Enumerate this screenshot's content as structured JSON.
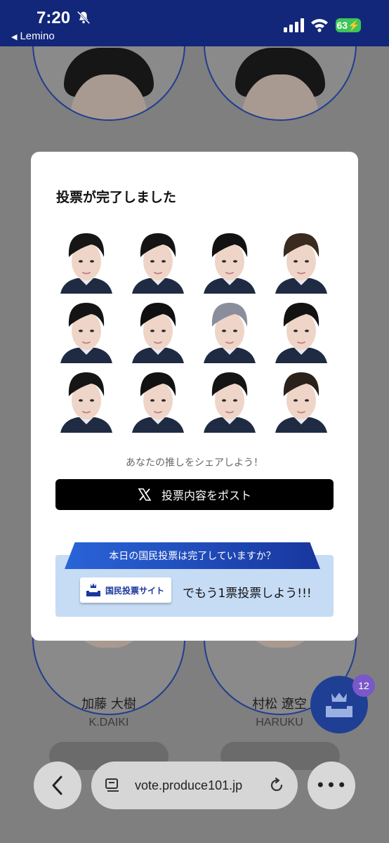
{
  "status_bar": {
    "time": "7:20",
    "back_app": "Lemino",
    "battery": "63"
  },
  "background": {
    "candidates": [
      {
        "name": "加藤 大樹",
        "romaji": "K.DAIKI"
      },
      {
        "name": "村松 遼空",
        "romaji": "HARUKU"
      }
    ],
    "fab_badge": "12"
  },
  "modal": {
    "title": "投票が完了しました",
    "share_hint": "あなたの推しをシェアしよう！",
    "post_button": "投票内容をポスト",
    "banner": "本日の国民投票は完了していますか？",
    "site_chip": "国民投票サイト",
    "vote_text": "でもう1票投票しよう!!!",
    "photo_count": 12
  },
  "browser": {
    "url": "vote.produce101.jp"
  },
  "colors": {
    "status_bar": "#12277a",
    "accent_blue": "#1f3f95",
    "banner_blue": "#2a64d8",
    "info_box": "#c6dcf5"
  }
}
